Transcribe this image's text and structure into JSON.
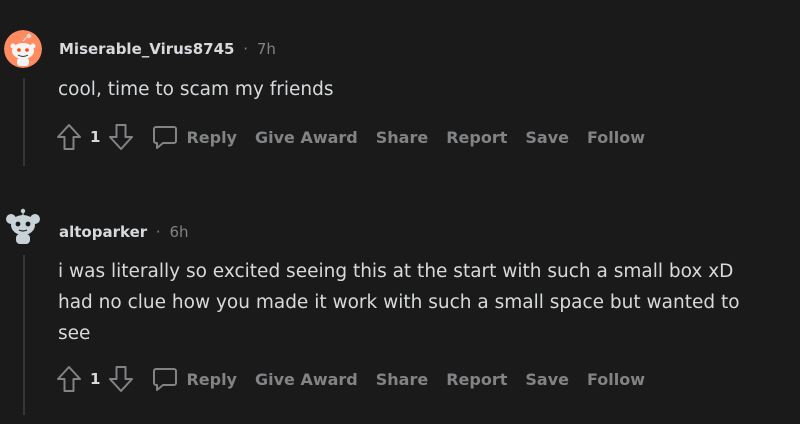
{
  "comments": [
    {
      "author": "Miserable_Virus8745",
      "separator": "·",
      "time": "7h",
      "lines": [
        "cool, time to scam my friends"
      ],
      "score": "1",
      "actions": {
        "reply": "Reply",
        "give_award": "Give Award",
        "share": "Share",
        "report": "Report",
        "save": "Save",
        "follow": "Follow"
      }
    },
    {
      "author": "altoparker",
      "separator": "·",
      "time": "6h",
      "lines": [
        "i was literally so excited seeing this at the start with such a small box xD",
        "had no clue how you made it work with such a small space but wanted to",
        "see"
      ],
      "score": "1",
      "actions": {
        "reply": "Reply",
        "give_award": "Give Award",
        "share": "Share",
        "report": "Report",
        "save": "Save",
        "follow": "Follow"
      }
    }
  ],
  "colors": {
    "background": "#1a1a1b",
    "text": "#d7dadc",
    "muted": "#818384",
    "avatar1": "#ff8b60",
    "avatar2": "#c8d3d8"
  }
}
